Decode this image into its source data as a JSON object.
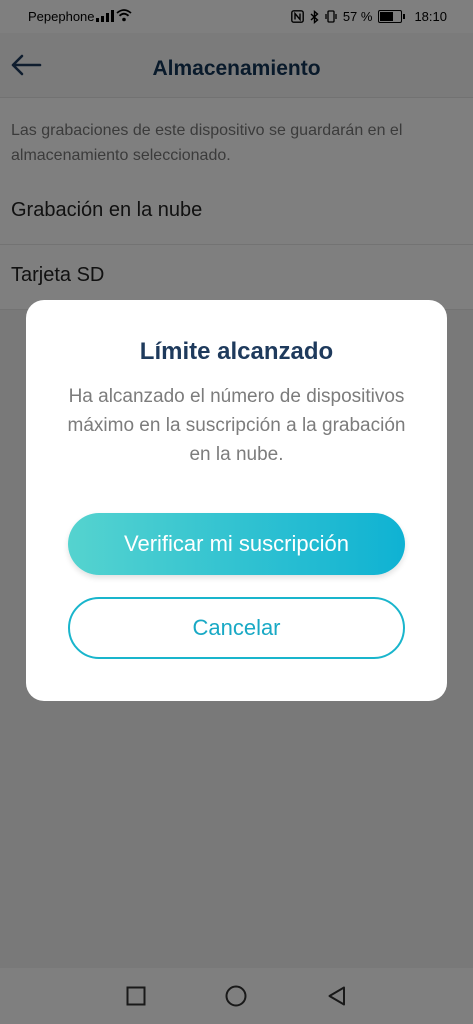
{
  "status_bar": {
    "carrier": "Pepephone",
    "battery": "57 %",
    "time": "18:10",
    "battery_fraction": 0.57
  },
  "header": {
    "title": "Almacenamiento",
    "back_icon": "arrow-left-icon"
  },
  "description": "Las grabaciones de este dispositivo se guardarán en el almacenamiento seleccionado.",
  "options": [
    {
      "label": "Grabación en la nube"
    },
    {
      "label": "Tarjeta SD"
    }
  ],
  "dialog": {
    "title": "Límite alcanzado",
    "message": "Ha alcanzado el número de dispositivos máximo en la suscripción a la grabación en la nube.",
    "primary_label": "Verificar mi suscripción",
    "secondary_label": "Cancelar",
    "primary_gradient": [
      "#55d3cf",
      "#0fb2d3"
    ],
    "accent_color": "#19b5cc",
    "title_color": "#1e3a5c"
  },
  "nav_bar": {
    "icons": [
      "square-recents-icon",
      "circle-home-icon",
      "triangle-back-icon"
    ]
  }
}
